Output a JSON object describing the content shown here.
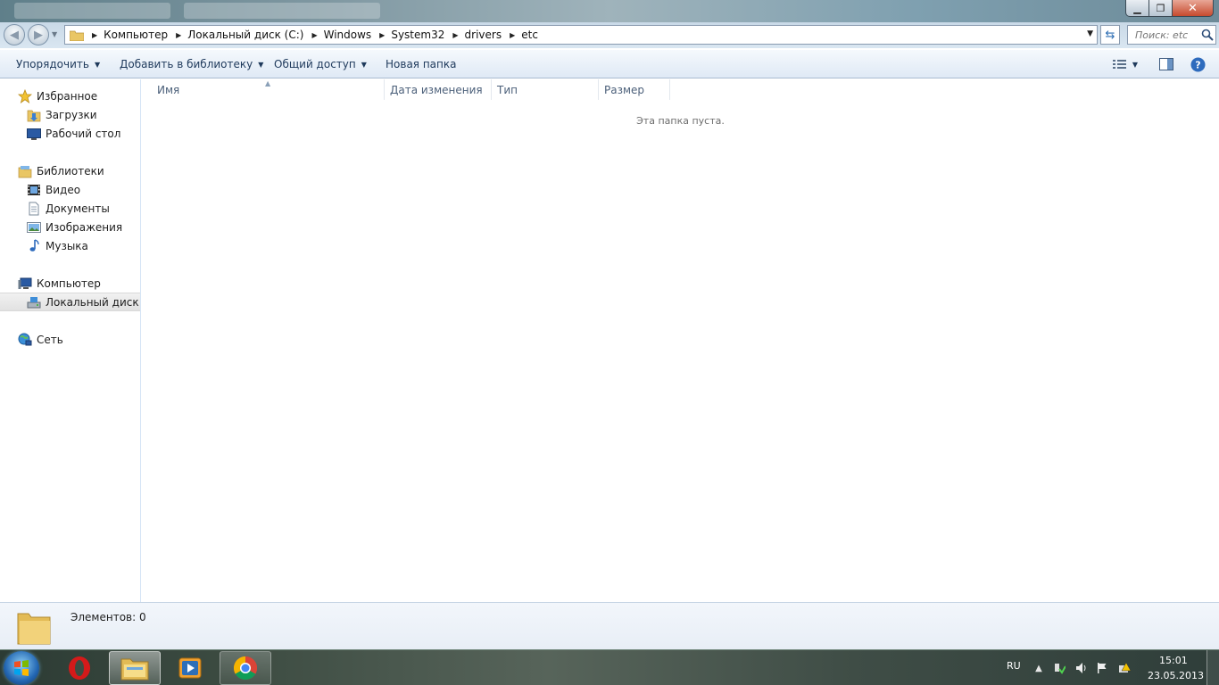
{
  "address_bar": {
    "crumbs": [
      "Компьютер",
      "Локальный диск (C:)",
      "Windows",
      "System32",
      "drivers",
      "etc"
    ]
  },
  "search": {
    "placeholder": "Поиск: etc"
  },
  "toolbar": {
    "organize": "Упорядочить",
    "add_to_library": "Добавить в библиотеку",
    "share": "Общий доступ",
    "new_folder": "Новая папка"
  },
  "navpane": {
    "favorites": "Избранное",
    "downloads": "Загрузки",
    "desktop": "Рабочий стол",
    "libraries": "Библиотеки",
    "video": "Видео",
    "documents": "Документы",
    "images": "Изображения",
    "music": "Музыка",
    "computer": "Компьютер",
    "local_disk": "Локальный диск (C:)",
    "network": "Сеть"
  },
  "columns": {
    "name": "Имя",
    "date_modified": "Дата изменения",
    "type": "Тип",
    "size": "Размер"
  },
  "content": {
    "empty_message": "Эта папка пуста."
  },
  "details": {
    "item_count": "Элементов: 0"
  },
  "tray": {
    "language": "RU",
    "time": "15:01",
    "date": "23.05.2013"
  },
  "icons": {
    "back": "back-arrow-icon",
    "forward": "forward-arrow-icon",
    "refresh": "refresh-icon",
    "search": "search-icon",
    "view_options": "view-options-icon",
    "preview_pane": "preview-pane-icon",
    "help": "help-icon"
  },
  "colors": {
    "toolbar_text": "#1e395b",
    "column_header_text": "#4c607a",
    "nav_border": "#d6e5f5"
  }
}
